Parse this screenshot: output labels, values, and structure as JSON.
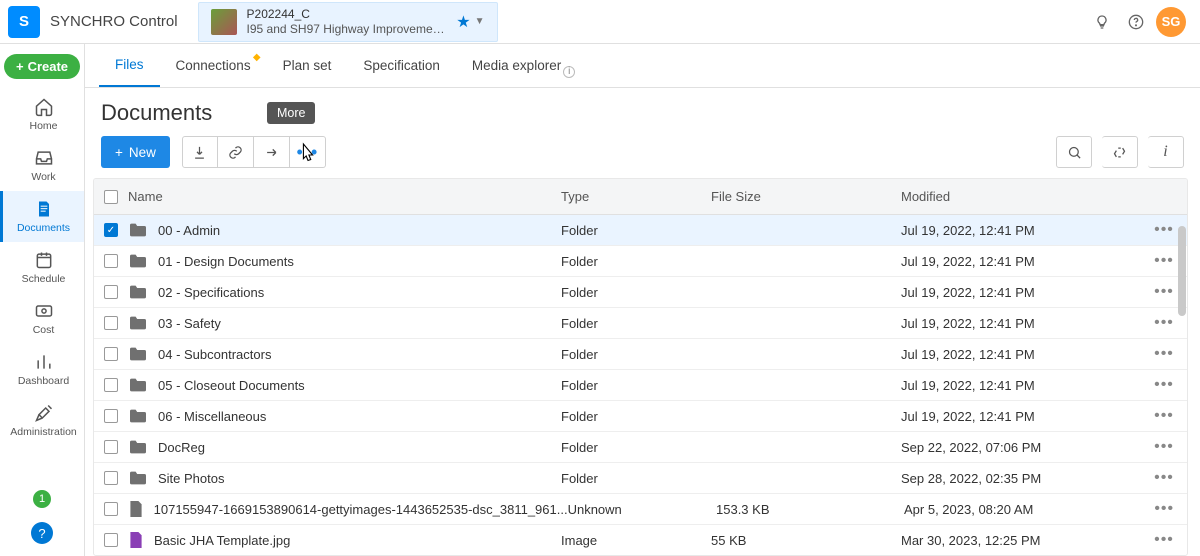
{
  "app": {
    "name": "SYNCHRO Control",
    "logo_text": "S"
  },
  "project": {
    "code": "P202244_C",
    "desc": "I95 and SH97 Highway Improvemen..."
  },
  "user": {
    "initials": "SG"
  },
  "leftrail": {
    "create": "Create",
    "items": [
      {
        "id": "home",
        "label": "Home"
      },
      {
        "id": "work",
        "label": "Work"
      },
      {
        "id": "documents",
        "label": "Documents"
      },
      {
        "id": "schedule",
        "label": "Schedule"
      },
      {
        "id": "cost",
        "label": "Cost"
      },
      {
        "id": "dashboard",
        "label": "Dashboard"
      },
      {
        "id": "administration",
        "label": "Administration"
      }
    ],
    "notif_count": "1"
  },
  "tabs": [
    {
      "id": "files",
      "label": "Files",
      "active": true
    },
    {
      "id": "connections",
      "label": "Connections",
      "flag": true
    },
    {
      "id": "planset",
      "label": "Plan set"
    },
    {
      "id": "spec",
      "label": "Specification"
    },
    {
      "id": "media",
      "label": "Media explorer",
      "info": true
    }
  ],
  "page": {
    "title": "Documents"
  },
  "toolbar": {
    "new": "New",
    "tooltip_more": "More"
  },
  "columns": {
    "name": "Name",
    "type": "Type",
    "size": "File Size",
    "modified": "Modified"
  },
  "rows": [
    {
      "name": "00 - Admin",
      "type": "Folder",
      "size": "",
      "modified": "Jul 19, 2022, 12:41 PM",
      "icon": "folder",
      "selected": true
    },
    {
      "name": "01 - Design Documents",
      "type": "Folder",
      "size": "",
      "modified": "Jul 19, 2022, 12:41 PM",
      "icon": "folder"
    },
    {
      "name": "02 - Specifications",
      "type": "Folder",
      "size": "",
      "modified": "Jul 19, 2022, 12:41 PM",
      "icon": "folder"
    },
    {
      "name": "03 - Safety",
      "type": "Folder",
      "size": "",
      "modified": "Jul 19, 2022, 12:41 PM",
      "icon": "folder"
    },
    {
      "name": "04 - Subcontractors",
      "type": "Folder",
      "size": "",
      "modified": "Jul 19, 2022, 12:41 PM",
      "icon": "folder"
    },
    {
      "name": "05 - Closeout Documents",
      "type": "Folder",
      "size": "",
      "modified": "Jul 19, 2022, 12:41 PM",
      "icon": "folder"
    },
    {
      "name": "06 - Miscellaneous",
      "type": "Folder",
      "size": "",
      "modified": "Jul 19, 2022, 12:41 PM",
      "icon": "folder"
    },
    {
      "name": "DocReg",
      "type": "Folder",
      "size": "",
      "modified": "Sep 22, 2022, 07:06 PM",
      "icon": "folder"
    },
    {
      "name": "Site Photos",
      "type": "Folder",
      "size": "",
      "modified": "Sep 28, 2022, 02:35 PM",
      "icon": "folder"
    },
    {
      "name": "107155947-1669153890614-gettyimages-1443652535-dsc_3811_961...",
      "type": "Unknown",
      "size": "153.3 KB",
      "modified": "Apr 5, 2023, 08:20 AM",
      "icon": "file"
    },
    {
      "name": "Basic JHA Template.jpg",
      "type": "Image",
      "size": "55 KB",
      "modified": "Mar 30, 2023, 12:25 PM",
      "icon": "image"
    }
  ]
}
